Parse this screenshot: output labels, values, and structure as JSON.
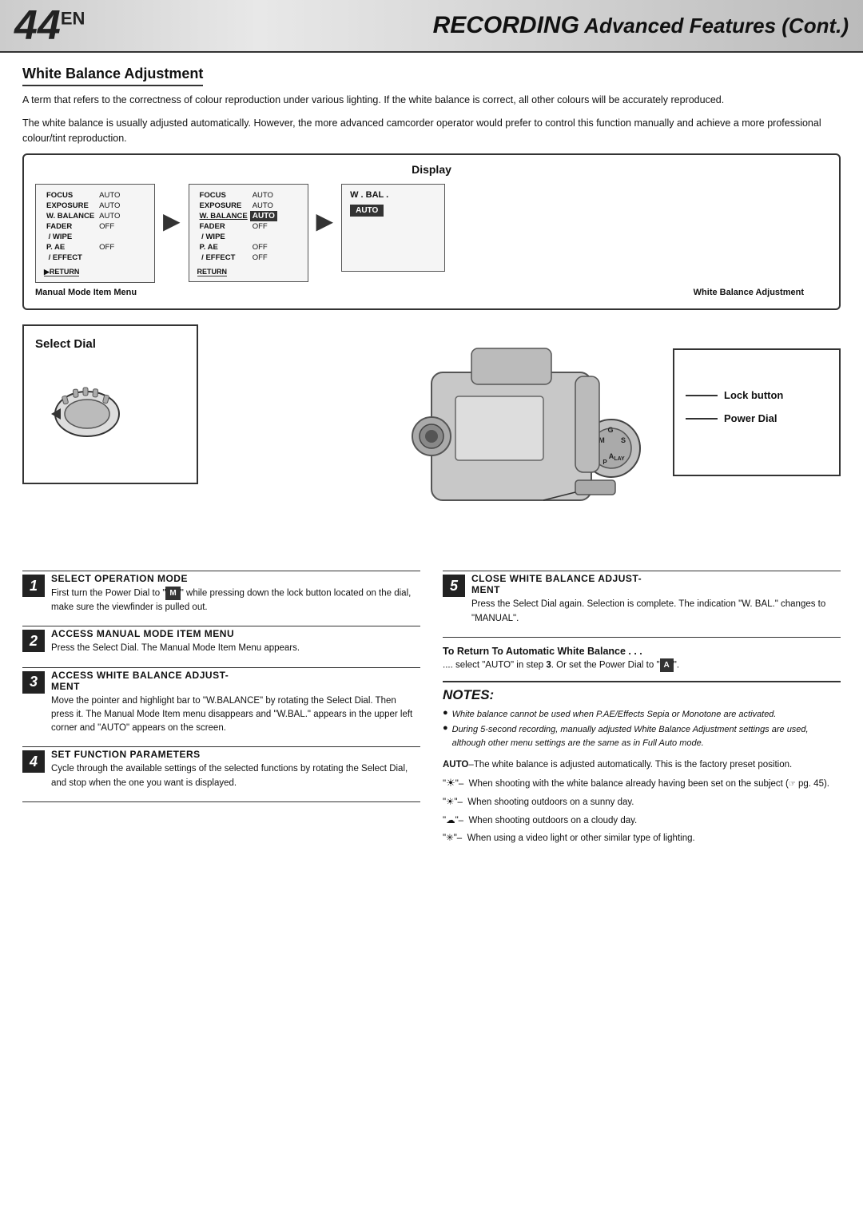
{
  "header": {
    "page_number": "44",
    "page_number_suffix": "EN",
    "title_recording": "RECORDING",
    "title_rest": " Advanced Features (Cont.)"
  },
  "section": {
    "title": "White Balance Adjustment",
    "intro1": "A term that refers to the correctness of colour reproduction under various lighting. If the white balance is correct, all other colours will be accurately reproduced.",
    "intro2": "The white balance is usually adjusted automatically. However, the more advanced camcorder operator would prefer to control this function manually and achieve a more professional colour/tint reproduction."
  },
  "display_diagram": {
    "title": "Display",
    "screen1": {
      "rows": [
        {
          "label": "FOCUS",
          "val": "AUTO"
        },
        {
          "label": "EXPOSURE",
          "val": "AUTO"
        },
        {
          "label": "W. BALANCE",
          "val": "AUTO"
        },
        {
          "label": "FADER",
          "val": "OFF"
        },
        {
          "label": "/ WIPE",
          "val": ""
        },
        {
          "label": "P. AE",
          "val": "OFF"
        },
        {
          "label": "/ EFFECT",
          "val": ""
        }
      ],
      "return_label": "RETURN",
      "caption": "Manual Mode Item Menu"
    },
    "screen2": {
      "rows": [
        {
          "label": "FOCUS",
          "val": "AUTO"
        },
        {
          "label": "EXPOSURE",
          "val": "AUTO"
        },
        {
          "label": "W. BALANCE",
          "val": "AUTO",
          "highlight": true
        },
        {
          "label": "FADER",
          "val": "OFF"
        },
        {
          "label": "/ WIPE",
          "val": ""
        },
        {
          "label": "P. AE",
          "val": "OFF"
        },
        {
          "label": "/ EFFECT",
          "val": ""
        }
      ],
      "return_label": "RETURN"
    },
    "screen3": {
      "wbal": "W. BAL .",
      "auto": "AUTO",
      "caption": "White Balance Adjustment"
    }
  },
  "diagram": {
    "select_dial_label": "Select Dial",
    "lock_button_label": "Lock button",
    "power_dial_label": "Power Dial"
  },
  "steps": [
    {
      "number": "1",
      "heading": "SELECT OPERATION MODE",
      "text": "First turn the Power Dial to \"ⓜ\" while pressing down the lock button located on the dial, make sure the viewfinder is pulled out."
    },
    {
      "number": "2",
      "heading": "ACCESS MANUAL MODE ITEM MENU",
      "text": "Press the Select Dial. The Manual Mode Item Menu appears."
    },
    {
      "number": "3",
      "heading": "ACCESS WHITE BALANCE ADJUSTMENT",
      "text": "Move the pointer and highlight bar to \"W.BALANCE\" by rotating the Select Dial. Then press it. The Manual Mode Item menu disappears and \"W.BAL.\" appears in the upper left corner and \"AUTO\" appears on the screen."
    },
    {
      "number": "4",
      "heading": "SET FUNCTION PARAMETERS",
      "text": "Cycle through the available settings of the selected functions by rotating the Select Dial, and stop when the one you want is displayed."
    },
    {
      "number": "5",
      "heading": "CLOSE WHITE BALANCE ADJUSTMENT",
      "text": "Press the Select Dial again. Selection is complete. The indication \"W. BAL.\" changes to  \"MANUAL\"."
    }
  ],
  "to_return": {
    "heading": "To Return To Automatic White Balance . . .",
    "text": ".... select \"AUTO\" in step 3. Or set the Power Dial to \"Ⓐ\"."
  },
  "notes": {
    "heading": "NOTES:",
    "items": [
      "White balance cannot be used when P.AE/Effects Sepia or Monotone are activated.",
      "During 5-second recording, manually adjusted White Balance Adjustment settings are used, although other menu settings are the same as in Full Auto mode."
    ]
  },
  "bottom_desc": {
    "auto_line": "AUTO–The white balance is adjusted automatically. This is the factory preset position.",
    "items": [
      {
        "symbol": "\"☉\"",
        "text": " When shooting with the white balance already having been set on the subject (→ pg. 45)."
      },
      {
        "symbol": "\"☀\"",
        "text": " When shooting outdoors on a sunny day."
      },
      {
        "symbol": "\"☁\"",
        "text": " When shooting outdoors on a cloudy day."
      },
      {
        "symbol": "\"✳\"",
        "text": " When using a video light or other similar type of lighting."
      }
    ]
  }
}
